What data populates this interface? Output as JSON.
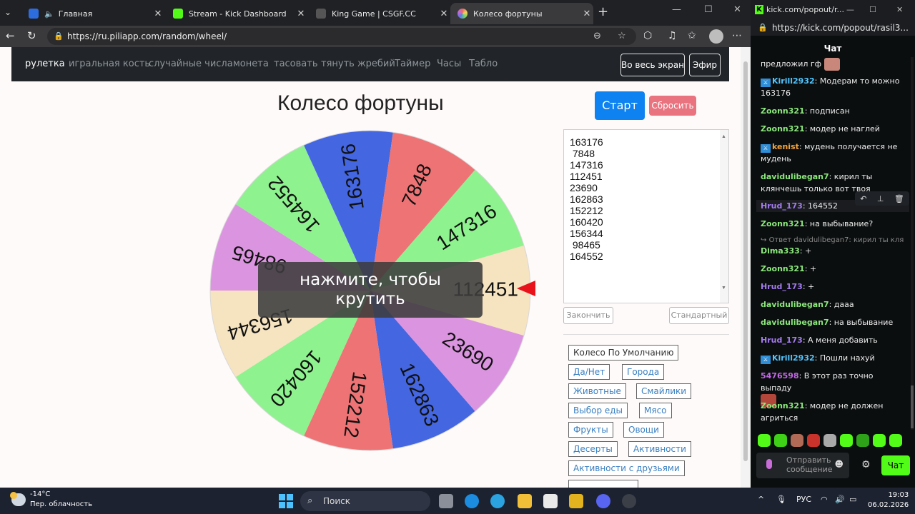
{
  "browser": {
    "tabs": [
      {
        "title": "Главная",
        "favicon_color": "#2d6cdf"
      },
      {
        "title": "Stream - Kick Dashboard",
        "favicon_color": "#53fc18"
      },
      {
        "title": "King Game | CSGF.CC",
        "favicon_color": "#555555"
      },
      {
        "title": "Колесо фортуны",
        "favicon_color": "#c06ad8"
      }
    ],
    "url": "https://ru.piliapp.com/random/wheel/"
  },
  "site": {
    "nav": [
      "рулетка",
      "игральная кость",
      "случайные числа",
      "монета",
      "тасовать",
      "тянуть жребий",
      "Таймер",
      "Часы",
      "Табло"
    ],
    "fullscreen_label": "Во весь экран",
    "broadcast_label": "Эфир",
    "title": "Колесо фортуны",
    "start_label": "Старт",
    "reset_label": "Сбросить",
    "spin_hint_line1": "нажмите, чтобы",
    "spin_hint_line2": "крутить",
    "finish_label": "Закончить",
    "standard_label": "Стандартный",
    "presets": [
      "Колесо По Умолчанию",
      "Да/Нет",
      "Города",
      "Животные",
      "Смайлики",
      "Выбор еды",
      "Мясо",
      "Фрукты",
      "Овощи",
      "Десерты",
      "Активности",
      "Активности с друзьями"
    ]
  },
  "wheel": {
    "entries_text": "163176\n 7848\n147316\n112451\n23690\n162863\n152212\n160420\n156344\n 98465\n164552",
    "segments": [
      {
        "label": "112451",
        "color": "#f6e3c0"
      },
      {
        "label": "23690",
        "color": "#db95e0"
      },
      {
        "label": "162863",
        "color": "#4466e0"
      },
      {
        "label": "152212",
        "color": "#ee7375"
      },
      {
        "label": "160420",
        "color": "#8ef28f"
      },
      {
        "label": "156344",
        "color": "#f6e3c0"
      },
      {
        "label": "98465",
        "color": "#db95e0"
      },
      {
        "label": "164552",
        "color": "#8ef28f"
      },
      {
        "label": "163176",
        "color": "#4466e0"
      },
      {
        "label": "7848",
        "color": "#ee7375"
      },
      {
        "label": "147316",
        "color": "#8ef28f"
      }
    ]
  },
  "kick": {
    "window_title": "kick.com/popout/r...",
    "url": "https://kick.com/popout/rasil3...",
    "header": "Чат",
    "input_placeholder": "Отправить сообщение",
    "chat_button": "Чат",
    "messages": [
      {
        "user": "",
        "text": "предложил гф",
        "color": "#ffffff"
      },
      {
        "user": "Kirill2932",
        "text": ": Модерам то можно 163176",
        "color": "#53c6ff"
      },
      {
        "user": "Zoonn321",
        "text": ": подписан",
        "color": "#8be87b"
      },
      {
        "user": "Zoonn321",
        "text": ": модер не наглей",
        "color": "#8be87b"
      },
      {
        "user": "kenist",
        "text": ": мудень получается не мудень",
        "color": "#f3a33c"
      },
      {
        "user": "davidulibegan7",
        "text": ": кирил ты клянчешь только вот твоя работа? без обид",
        "color": "#8be87b"
      },
      {
        "user": "Hrud_173",
        "text": ": 164552",
        "color": "#a47cf0"
      },
      {
        "user": "Zoonn321",
        "text": ": на выбывание?",
        "color": "#8be87b"
      },
      {
        "user": "",
        "text": "Ответ davidulibegan7: кирил ты кля...",
        "color": "#8a8a8a"
      },
      {
        "user": "Dima333",
        "text": ": +",
        "color": "#8be87b"
      },
      {
        "user": "Zoonn321",
        "text": ": +",
        "color": "#8be87b"
      },
      {
        "user": "Hrud_173",
        "text": ": +",
        "color": "#a47cf0"
      },
      {
        "user": "davidulibegan7",
        "text": ": дааа",
        "color": "#8be87b"
      },
      {
        "user": "davidulibegan7",
        "text": ": на выбывание",
        "color": "#8be87b"
      },
      {
        "user": "Hrud_173",
        "text": ": А меня добавить",
        "color": "#a47cf0"
      },
      {
        "user": "Kirill2932",
        "text": ": Пошли нахуй",
        "color": "#53c6ff"
      },
      {
        "user": "5476598",
        "text": ": В этот раз точно выпаду",
        "color": "#c16ae4"
      },
      {
        "user": "Zoonn321",
        "text": ": модер не должен агриться",
        "color": "#8be87b"
      }
    ]
  },
  "taskbar": {
    "temperature": "-14°C",
    "condition": "Пер. облачность",
    "search_label": "Поиск",
    "lang": "РУС",
    "time": "19:03",
    "date": "06.02.2026"
  }
}
